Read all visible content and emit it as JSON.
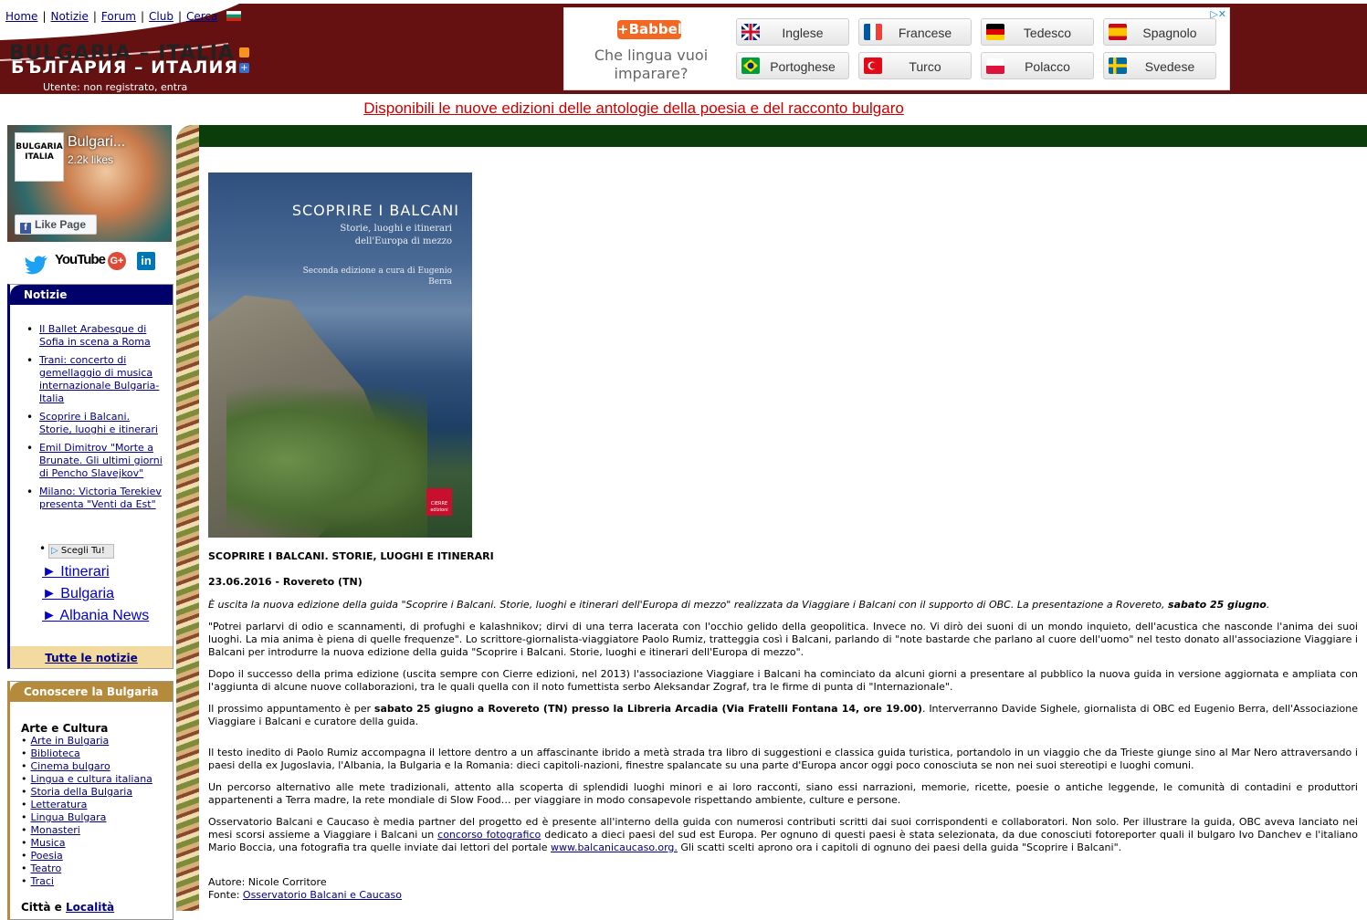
{
  "header": {
    "nav": [
      "Home",
      "Notizie",
      "Forum",
      "Club",
      "Cerca"
    ],
    "logo_title": "BULGARIA – ITALIA",
    "logo_sub": "БЪЛГАРИЯ – ИТАЛИЯ",
    "user_status": "Utente: non registrato, entra"
  },
  "ad": {
    "brand": "+Babbel",
    "question": "Che lingua vuoi imparare?",
    "languages": [
      "Inglese",
      "Francese",
      "Tedesco",
      "Spagnolo",
      "Portoghese",
      "Turco",
      "Polacco",
      "Svedese"
    ],
    "choices": "▷✕"
  },
  "promo": {
    "text": "Disponibili le nuove edizioni delle antologie della poesia e del racconto bulgaro"
  },
  "facebook": {
    "name": "Bulgari...",
    "likes": "2.2k likes",
    "like_button": "Like Page",
    "logo_text": "BULGARIA ITALIA"
  },
  "social": {
    "youtube": "YouTube",
    "linkedin": "in",
    "googleplus": "G+"
  },
  "notizie": {
    "title": "Notizie",
    "items": [
      "Il Ballet Arabesque di Sofia in scena a Roma",
      "Trani: concerto di gemellaggio di musica internazionale Bulgaria-Italia",
      "Scoprire i Balcani. Storie, luoghi e itinerari",
      "Emil Dimitrov \"Morte a Brunate. Gli ultimi giorni di Pencho Slavejkov\"",
      "Milano: Victoria Terekiev presenta \"Venti da Est\""
    ],
    "scegli": "Scegli Tu!",
    "links": [
      "► Itinerari",
      "► Bulgaria",
      "► Albania News"
    ],
    "all_link": "Tutte le notizie"
  },
  "conoscere": {
    "title": "Conoscere la Bulgaria",
    "category": "Arte e Cultura",
    "items": [
      "Arte in Bulgaria",
      "Biblioteca",
      "Cinema bulgaro",
      "Lingua e cultura italiana",
      "Storia della Bulgaria",
      "Letteratura",
      "Lingua Bulgara",
      "Monasteri",
      "Musica",
      "Poesia",
      "Teatro",
      "Traci"
    ],
    "citta_prefix": "Città e ",
    "citta_link": "Località"
  },
  "cover": {
    "title": "SCOPRIRE I BALCANI",
    "subtitle": "Storie, luoghi e itinerari dell'Europa di mezzo",
    "edition": "Seconda edizione a cura di Eugenio Berra",
    "publisher": "CIERRE edizioni"
  },
  "article": {
    "title": "SCOPRIRE I BALCANI. STORIE, LUOGHI E ITINERARI",
    "date": "23.06.2016 - Rovereto (TN)",
    "lead": "È uscita la nuova edizione della guida \"Scoprire i Balcani. Storie, luoghi e itinerari dell'Europa di mezzo\" realizzata da Viaggiare i Balcani con il supporto di OBC. La presentazione a Rovereto, ",
    "lead_bold": "sabato 25 giugno",
    "p1": "\"Potrei parlarvi di odio e scannamenti, di profughi e kalashnikov; dirvi di una terra lacerata con l'occhio gelido della geopolitica. Invece no. Vi dirò dei suoni di un mondo inquieto, dell'acustica che nasconde l'anima dei suoi luoghi. La mia anima è piena di quelle frequenze\". Lo scrittore-giornalista-viaggiatore Paolo Rumiz, tratteggia così i Balcani, parlando di \"note bastarde che parlano al cuore dell'uomo\" nel testo donato all'associazione Viaggiare i Balcani per introdurre la nuova edizione della guida \"Scoprire i Balcani. Storie, luoghi e itinerari dell'Europa di mezzo\".",
    "p2": "Dopo il successo della prima edizione (uscita sempre con Cierre edizioni, nel 2013) l'associazione Viaggiare i Balcani ha cominciato da alcuni giorni a presentare al pubblico la nuova guida in versione aggiornata e ampliata con l'aggiunta di alcune nuove collaborazioni, tra le quali quella con il noto fumettista serbo Aleksandar Zograf, tra le firme di punta di \"Internazionale\".",
    "p3_pre": "Il prossimo appuntamento è per ",
    "p3_bold": "sabato 25 giugno a Rovereto (TN) presso la Libreria Arcadia (Via Fratelli Fontana 14, ore 19.00)",
    "p3_post": ". Interverranno Davide Sighele, giornalista di OBC ed Eugenio Berra, dell'Associazione Viaggiare i Balcani e curatore della guida.",
    "p4": "Il testo inedito di Paolo Rumiz accompagna il lettore dentro a un affascinante ibrido a metà strada tra libro di suggestioni e classica guida turistica, portandolo in un viaggio che da Trieste giunge sino al Mar Nero attraversando i paesi della ex Jugoslavia, l'Albania, la Bulgaria e la Romania: dieci capitoli-nazioni, finestre spalancate su una parte d'Europa ancor oggi poco conosciuta se non nei suoi stereotipi e luoghi comuni.",
    "p5": "Un percorso alternativo alle mete tradizionali, attento alla scoperta di splendidi luoghi minori e ai loro racconti, siano essi narrazioni, memorie, ricette, poesie o antiche leggende, le comunità di contadini e produttori appartenenti a Terra madre, la rete mondiale di Slow Food… per viaggiare in modo consapevole rispettando ambiente, culture e persone.",
    "p6_a": "Osservatorio Balcani e Caucaso è media partner del progetto ed è presente all'interno della guida con numerosi contributi scritti dai suoi corrispondenti e collaboratori. Non solo. Per illustrare la guida, OBC aveva lanciato nei mesi scorsi assieme a Viaggiare i Balcani un ",
    "p6_link1": "concorso fotografico",
    "p6_b": " dedicato a dieci paesi del sud est Europa. Per ognuno di questi paesi è stata selezionata, da due conosciuti fotoreporter quali il bulgaro Ivo Danchev e l'italiano Mario Boccia, una fotografia tra quelle inviate dai lettori del portale ",
    "p6_link2": "www.balcanicaucaso.org.",
    "p6_c": " Gli scatti scelti aprono ora i capitoli di ognuno dei paesi della guida \"Scoprire i Balcani\".",
    "author": "Autore: Nicole Corritore",
    "source_label": "Fonte: ",
    "source_link": "Osservatorio Balcani e Caucaso"
  },
  "colors": {
    "header_bar": "#661111",
    "notizie_title": "#00006b",
    "conoscere_title": "#b58a3a",
    "main_top": "#0b3d0b",
    "promo_link": "#cc0000",
    "babbel": "#f26722"
  }
}
